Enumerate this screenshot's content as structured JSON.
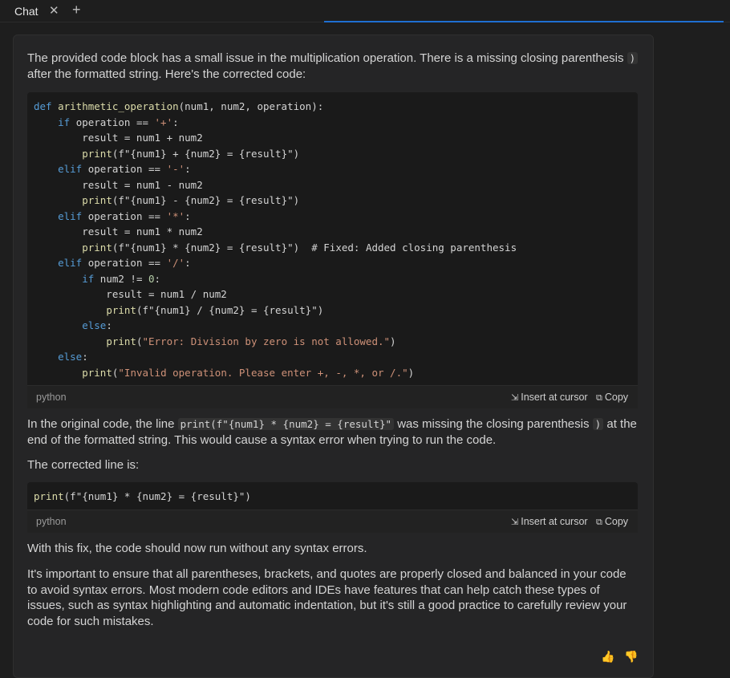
{
  "tabbar": {
    "title": "Chat",
    "close_glyph": "✕",
    "add_glyph": "+"
  },
  "message": {
    "intro_before": "The provided code block has a small issue in the multiplication operation. There is a missing closing parenthesis ",
    "intro_code": ")",
    "intro_after": " after the formatted string. Here's the corrected code:",
    "code_block_1": {
      "language": "python",
      "lines": [
        [
          [
            "kw",
            "def "
          ],
          [
            "fn",
            "arithmetic_operation"
          ],
          [
            "",
            "(num1, num2, operation):"
          ]
        ],
        [
          [
            "",
            "    "
          ],
          [
            "kw",
            "if"
          ],
          [
            "",
            " operation == "
          ],
          [
            "str",
            "'+'"
          ],
          [
            "",
            ":"
          ]
        ],
        [
          [
            "",
            "        result = num1 + num2"
          ]
        ],
        [
          [
            "",
            "        "
          ],
          [
            "fn",
            "print"
          ],
          [
            "",
            "(f\"{num1} + {num2} = {result}\")"
          ]
        ],
        [
          [
            "",
            "    "
          ],
          [
            "kw",
            "elif"
          ],
          [
            "",
            " operation == "
          ],
          [
            "str",
            "'-'"
          ],
          [
            "",
            ":"
          ]
        ],
        [
          [
            "",
            "        result = num1 - num2"
          ]
        ],
        [
          [
            "",
            "        "
          ],
          [
            "fn",
            "print"
          ],
          [
            "",
            "(f\"{num1} - {num2} = {result}\")"
          ]
        ],
        [
          [
            "",
            "    "
          ],
          [
            "kw",
            "elif"
          ],
          [
            "",
            " operation == "
          ],
          [
            "str",
            "'*'"
          ],
          [
            "",
            ":"
          ]
        ],
        [
          [
            "",
            "        result = num1 * num2"
          ]
        ],
        [
          [
            "",
            "        "
          ],
          [
            "fn",
            "print"
          ],
          [
            "",
            "(f\"{num1} * {num2} = {result}\")  "
          ],
          [
            "cm",
            "# Fixed: Added closing parenthesis"
          ]
        ],
        [
          [
            "",
            "    "
          ],
          [
            "kw",
            "elif"
          ],
          [
            "",
            " operation == "
          ],
          [
            "str",
            "'/'"
          ],
          [
            "",
            ":"
          ]
        ],
        [
          [
            "",
            "        "
          ],
          [
            "kw",
            "if"
          ],
          [
            "",
            " num2 != "
          ],
          [
            "num",
            "0"
          ],
          [
            "",
            ":"
          ]
        ],
        [
          [
            "",
            "            result = num1 / num2"
          ]
        ],
        [
          [
            "",
            "            "
          ],
          [
            "fn",
            "print"
          ],
          [
            "",
            "(f\"{num1} / {num2} = {result}\")"
          ]
        ],
        [
          [
            "",
            "        "
          ],
          [
            "kw",
            "else"
          ],
          [
            "",
            ":"
          ]
        ],
        [
          [
            "",
            "            "
          ],
          [
            "fn",
            "print"
          ],
          [
            "",
            "("
          ],
          [
            "str",
            "\"Error: Division by zero is not allowed.\""
          ],
          [
            "",
            ")"
          ]
        ],
        [
          [
            "",
            "    "
          ],
          [
            "kw",
            "else"
          ],
          [
            "",
            ":"
          ]
        ],
        [
          [
            "",
            "        "
          ],
          [
            "fn",
            "print"
          ],
          [
            "",
            "("
          ],
          [
            "str",
            "\"Invalid operation. Please enter +, -, *, or /.\""
          ],
          [
            "",
            ")"
          ]
        ]
      ]
    },
    "explain_before": "In the original code, the line ",
    "explain_code": "print(f\"{num1} * {num2} = {result}\"",
    "explain_mid": " was missing the closing parenthesis ",
    "explain_code2": ")",
    "explain_after": " at the end of the formatted string. This would cause a syntax error when trying to run the code.",
    "corrected_label": "The corrected line is:",
    "code_block_2": {
      "language": "python",
      "lines": [
        [
          [
            "fn",
            "print"
          ],
          [
            "",
            "(f\"{num1} * {num2} = {result}\")"
          ]
        ]
      ]
    },
    "fix_note": "With this fix, the code should now run without any syntax errors.",
    "closing": "It's important to ensure that all parentheses, brackets, and quotes are properly closed and balanced in your code to avoid syntax errors. Most modern code editors and IDEs have features that can help catch these types of issues, such as syntax highlighting and automatic indentation, but it's still a good practice to carefully review your code for such mistakes."
  },
  "actions": {
    "insert_label": "Insert at cursor",
    "copy_label": "Copy",
    "insert_icon": "⇲",
    "copy_icon": "⧉"
  },
  "feedback": {
    "thumbs_up": "👍",
    "thumbs_down": "👎"
  }
}
